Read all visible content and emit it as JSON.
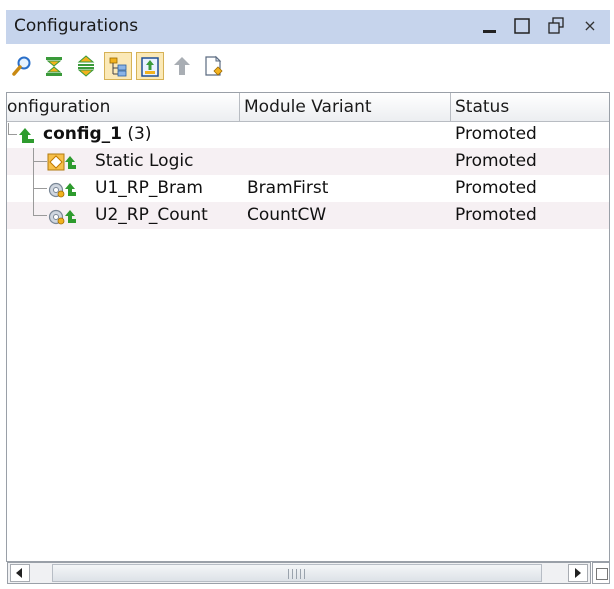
{
  "window": {
    "title": "Configurations",
    "close_glyph": "×"
  },
  "toolbar": {
    "buttons": [
      {
        "icon": "search-icon"
      },
      {
        "icon": "collapse-all-icon"
      },
      {
        "icon": "expand-all-icon"
      },
      {
        "icon": "hierarchy-view-icon",
        "toggled": true
      },
      {
        "icon": "auto-select-icon",
        "toggled": true
      },
      {
        "icon": "promote-icon",
        "disabled": true
      },
      {
        "icon": "new-configuration-icon"
      }
    ]
  },
  "table": {
    "columns": [
      "onfiguration",
      "Module Variant",
      "Status"
    ],
    "rows": [
      {
        "name": "config_1",
        "count": "(3)",
        "variant": "",
        "status": "Promoted",
        "level": 0
      },
      {
        "name": "Static Logic",
        "variant": "",
        "status": "Promoted",
        "level": 1
      },
      {
        "name": "U1_RP_Bram",
        "variant": "BramFirst",
        "status": "Promoted",
        "level": 1
      },
      {
        "name": "U2_RP_Count",
        "variant": "CountCW",
        "status": "Promoted",
        "level": 1
      }
    ]
  },
  "colors": {
    "titlebar_bg": "#c6d4ec",
    "promote_arrow": "#2e9b2e",
    "static_logic_icon": "#f0a020",
    "row_alt": "#f6f0f3"
  }
}
